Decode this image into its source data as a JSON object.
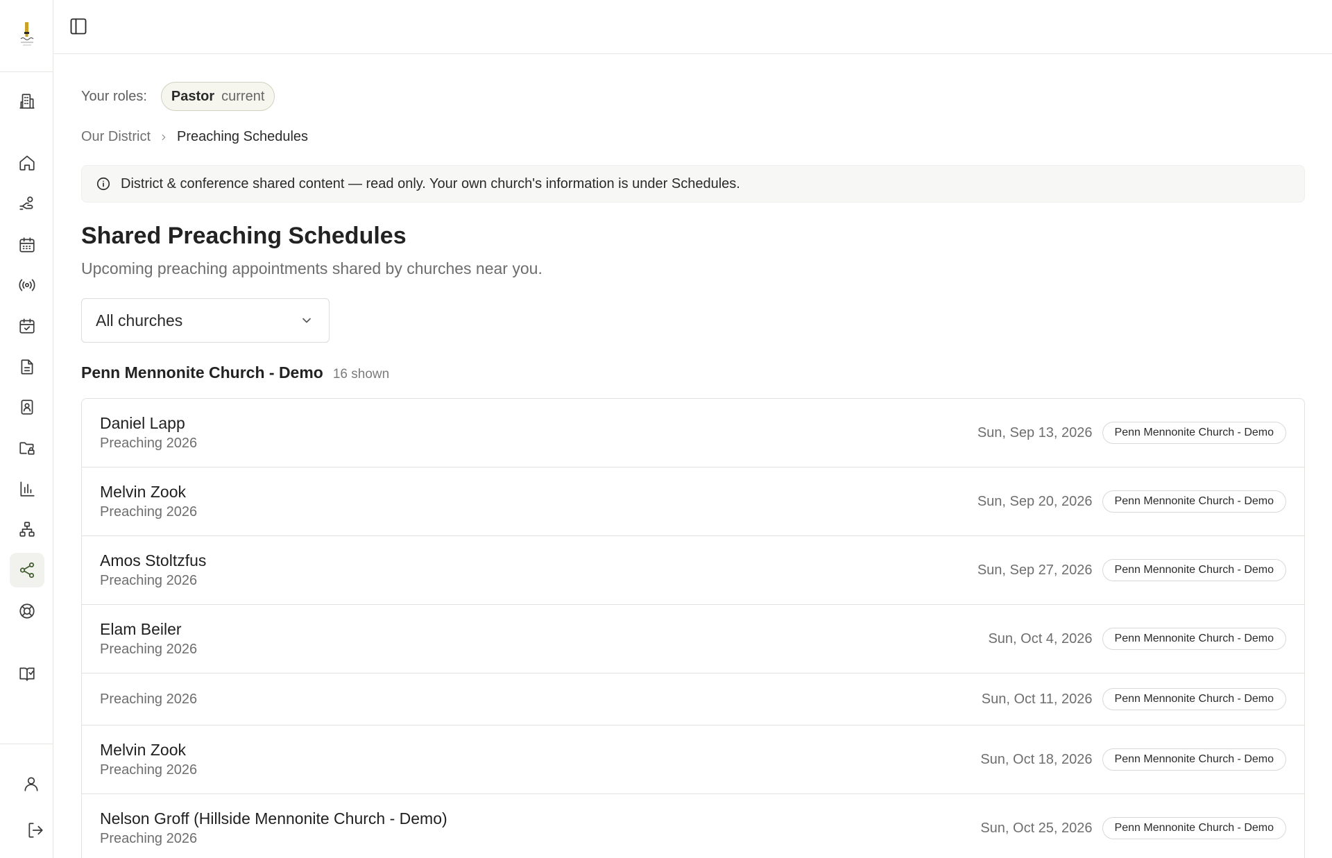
{
  "sidebar": {
    "nav": [
      {
        "name": "building-icon",
        "active": false
      },
      {
        "name": "home-icon",
        "active": false
      },
      {
        "name": "hand-coins-icon",
        "active": false
      },
      {
        "name": "calendar-icon",
        "active": false
      },
      {
        "name": "broadcast-icon",
        "active": false
      },
      {
        "name": "calendar-check-icon",
        "active": false
      },
      {
        "name": "document-icon",
        "active": false
      },
      {
        "name": "contact-book-icon",
        "active": false
      },
      {
        "name": "folder-lock-icon",
        "active": false
      },
      {
        "name": "bar-chart-icon",
        "active": false
      },
      {
        "name": "org-chart-icon",
        "active": false
      },
      {
        "name": "share-icon",
        "active": true
      },
      {
        "name": "lifebuoy-icon",
        "active": false
      },
      {
        "name": "book-check-icon",
        "active": false
      }
    ],
    "footer": [
      {
        "name": "user-icon"
      },
      {
        "name": "logout-icon"
      }
    ]
  },
  "roles": {
    "label": "Your roles:",
    "role": "Pastor",
    "role_tag": "current"
  },
  "breadcrumb": {
    "parent": "Our District",
    "current": "Preaching Schedules"
  },
  "banner": {
    "text": "District & conference shared content — read only. Your own church's information is under Schedules."
  },
  "page": {
    "title": "Shared Preaching Schedules",
    "subtitle": "Upcoming preaching appointments shared by churches near you."
  },
  "filter": {
    "selected": "All churches"
  },
  "group": {
    "name": "Penn Mennonite Church - Demo",
    "count": "16 shown"
  },
  "schedule": [
    {
      "preacher": "Daniel Lapp",
      "schedule": "Preaching 2026",
      "date": "Sun, Sep 13, 2026",
      "church": "Penn Mennonite Church - Demo"
    },
    {
      "preacher": "Melvin Zook",
      "schedule": "Preaching 2026",
      "date": "Sun, Sep 20, 2026",
      "church": "Penn Mennonite Church - Demo"
    },
    {
      "preacher": "Amos Stoltzfus",
      "schedule": "Preaching 2026",
      "date": "Sun, Sep 27, 2026",
      "church": "Penn Mennonite Church - Demo"
    },
    {
      "preacher": "Elam Beiler",
      "schedule": "Preaching 2026",
      "date": "Sun, Oct 4, 2026",
      "church": "Penn Mennonite Church - Demo"
    },
    {
      "preacher": "",
      "schedule": "Preaching 2026",
      "date": "Sun, Oct 11, 2026",
      "church": "Penn Mennonite Church - Demo"
    },
    {
      "preacher": "Melvin Zook",
      "schedule": "Preaching 2026",
      "date": "Sun, Oct 18, 2026",
      "church": "Penn Mennonite Church - Demo"
    },
    {
      "preacher": "Nelson Groff (Hillside Mennonite Church - Demo)",
      "schedule": "Preaching 2026",
      "date": "Sun, Oct 25, 2026",
      "church": "Penn Mennonite Church - Demo"
    }
  ],
  "colors": {
    "active_nav_bg": "#f1f1ee",
    "active_nav_fg": "#3f5a2a",
    "role_pill_border": "#cfd2bf",
    "logo_gold": "#c9a227"
  }
}
